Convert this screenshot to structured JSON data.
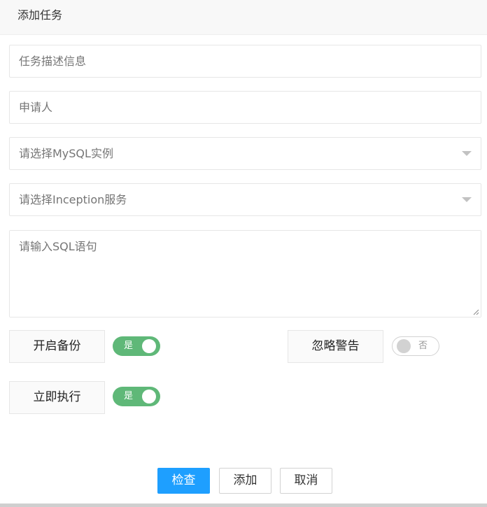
{
  "dialog": {
    "title": "添加任务"
  },
  "form": {
    "description": {
      "placeholder": "任务描述信息",
      "value": ""
    },
    "applicant": {
      "placeholder": "申请人",
      "value": ""
    },
    "mysql_instance": {
      "placeholder": "请选择MySQL实例"
    },
    "inception_service": {
      "placeholder": "请选择Inception服务"
    },
    "sql": {
      "placeholder": "请输入SQL语句",
      "value": ""
    }
  },
  "options": {
    "backup": {
      "label": "开启备份",
      "state": "是",
      "on": true
    },
    "ignore_warnings": {
      "label": "忽略警告",
      "state": "否",
      "on": false
    },
    "execute_now": {
      "label": "立即执行",
      "state": "是",
      "on": true
    }
  },
  "buttons": {
    "check": "检查",
    "add": "添加",
    "cancel": "取消"
  },
  "colors": {
    "primary": "#1e9fff",
    "switch_on": "#5fb878",
    "switch_off": "#d2d2d2"
  }
}
